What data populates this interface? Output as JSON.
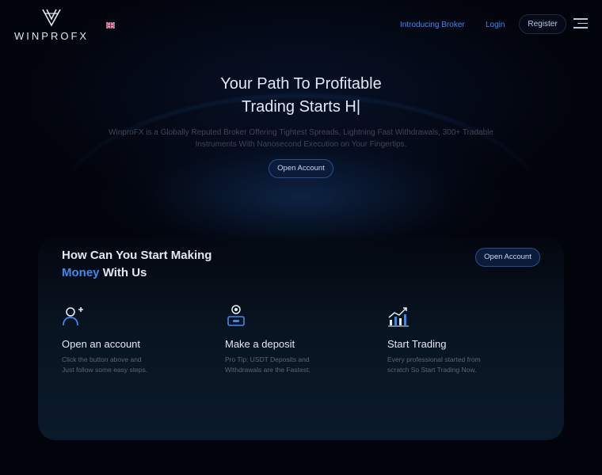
{
  "brand": {
    "name": "WINPROFX"
  },
  "header": {
    "language_flag": "uk-flag-icon",
    "nav": {
      "introducing_broker": "Introducing Broker",
      "login": "Login",
      "register": "Register"
    }
  },
  "hero": {
    "title_line1": "Your Path To Profitable",
    "title_line2": "Trading Starts H|",
    "subtitle": "WinproFX is a Globally Reputed Broker Offering Tightest Spreads, Lightning Fast Withdrawals, 300+ Tradable Instruments With Nanosecond Execution on Your Fingertips.",
    "cta": "Open Account"
  },
  "steps_section": {
    "title_part1": "How Can You Start Making",
    "title_highlight": "Money",
    "title_part2": "With Us",
    "cta": "Open Account",
    "steps": [
      {
        "icon": "add-user-icon",
        "title": "Open an account",
        "desc": "Click the button above and Just follow some easy steps."
      },
      {
        "icon": "deposit-icon",
        "title": "Make a deposit",
        "desc": "Pro Tip: USDT Deposits and Withdrawals are the Fastest."
      },
      {
        "icon": "chart-icon",
        "title": "Start Trading",
        "desc": "Every professional started from scratch So Start Trading Now."
      }
    ]
  },
  "colors": {
    "accent": "#3a8bf0",
    "background": "#02040b"
  }
}
